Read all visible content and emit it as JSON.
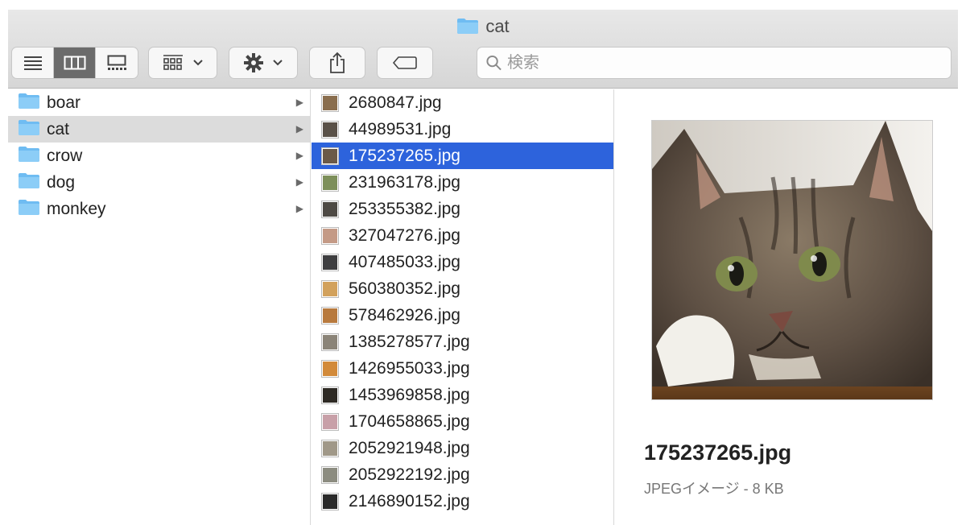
{
  "window": {
    "title": "cat"
  },
  "toolbar": {
    "view_modes": [
      "list-view",
      "column-view",
      "gallery-view"
    ],
    "active_view": "column-view"
  },
  "search": {
    "placeholder": "検索"
  },
  "sidebar_column": {
    "items": [
      {
        "label": "boar",
        "selected": false
      },
      {
        "label": "cat",
        "selected": true
      },
      {
        "label": "crow",
        "selected": false
      },
      {
        "label": "dog",
        "selected": false
      },
      {
        "label": "monkey",
        "selected": false
      }
    ]
  },
  "files_column": {
    "items": [
      {
        "label": "2680847.jpg",
        "thumb": "#8a6e4e"
      },
      {
        "label": "44989531.jpg",
        "thumb": "#5a5148"
      },
      {
        "label": "175237265.jpg",
        "thumb": "#6b5a48",
        "selected": true
      },
      {
        "label": "231963178.jpg",
        "thumb": "#7d8f5a"
      },
      {
        "label": "253355382.jpg",
        "thumb": "#4e4a44"
      },
      {
        "label": "327047276.jpg",
        "thumb": "#c49a86"
      },
      {
        "label": "407485033.jpg",
        "thumb": "#3e3e40"
      },
      {
        "label": "560380352.jpg",
        "thumb": "#d2a15c"
      },
      {
        "label": "578462926.jpg",
        "thumb": "#b87a3e"
      },
      {
        "label": "1385278577.jpg",
        "thumb": "#8b8478"
      },
      {
        "label": "1426955033.jpg",
        "thumb": "#d28a3a"
      },
      {
        "label": "1453969858.jpg",
        "thumb": "#2e2a24"
      },
      {
        "label": "1704658865.jpg",
        "thumb": "#c8a0a8"
      },
      {
        "label": "2052921948.jpg",
        "thumb": "#a09888"
      },
      {
        "label": "2052922192.jpg",
        "thumb": "#8c8c80"
      },
      {
        "label": "2146890152.jpg",
        "thumb": "#2a2a2a"
      }
    ]
  },
  "preview": {
    "file_name": "175237265.jpg",
    "info": "JPEGイメージ - 8 KB"
  },
  "colors": {
    "selection": "#2d63dc",
    "folder": "#6fbcf2"
  }
}
